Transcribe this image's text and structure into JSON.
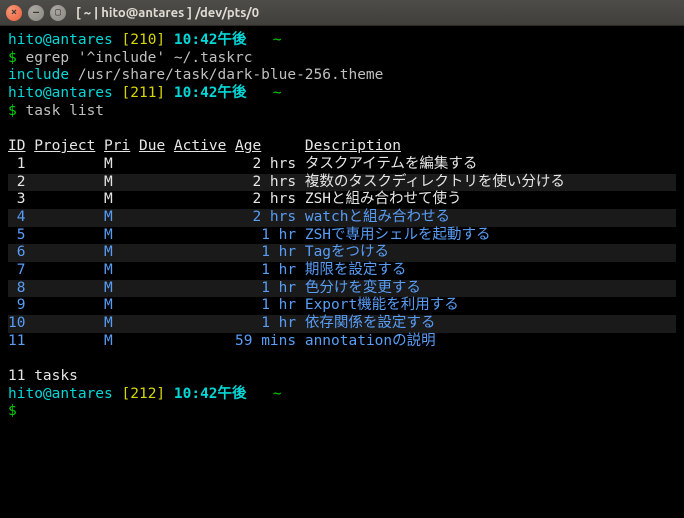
{
  "titlebar": {
    "title": "[ ~ | hito@antares ]  /dev/pts/0"
  },
  "prompt1": {
    "userhost": "hito@antares",
    "histnum": "[210]",
    "time": "10:42午後",
    "marker": "~"
  },
  "cmd1": {
    "dollar": "$",
    "text": "egrep '^include' ~/.taskrc"
  },
  "out1": {
    "word": "include",
    "rest": " /usr/share/task/dark-blue-256.theme"
  },
  "prompt2": {
    "userhost": "hito@antares",
    "histnum": "[211]",
    "time": "10:42午後",
    "marker": "~"
  },
  "cmd2": {
    "dollar": "$",
    "text": "task list"
  },
  "headers": {
    "id": "ID",
    "project": "Project",
    "pri": "Pri",
    "due": "Due",
    "active": "Active",
    "age": "Age",
    "desc": "Description"
  },
  "rows": [
    {
      "id": "1",
      "pri": "M",
      "age": "2 hrs",
      "desc": "タスクアイテムを編集する",
      "color": "white",
      "alt": false
    },
    {
      "id": "2",
      "pri": "M",
      "age": "2 hrs",
      "desc": "複数のタスクディレクトリを使い分ける",
      "color": "white",
      "alt": true
    },
    {
      "id": "3",
      "pri": "M",
      "age": "2 hrs",
      "desc": "ZSHと組み合わせて使う",
      "color": "white",
      "alt": false
    },
    {
      "id": "4",
      "pri": "M",
      "age": "2 hrs",
      "desc": "watchと組み合わせる",
      "color": "blue",
      "alt": true
    },
    {
      "id": "5",
      "pri": "M",
      "age": "1 hr",
      "desc": "ZSHで専用シェルを起動する",
      "color": "blue",
      "alt": false
    },
    {
      "id": "6",
      "pri": "M",
      "age": "1 hr",
      "desc": "Tagをつける",
      "color": "blue",
      "alt": true
    },
    {
      "id": "7",
      "pri": "M",
      "age": "1 hr",
      "desc": "期限を設定する",
      "color": "blue",
      "alt": false
    },
    {
      "id": "8",
      "pri": "M",
      "age": "1 hr",
      "desc": "色分けを変更する",
      "color": "blue",
      "alt": true
    },
    {
      "id": "9",
      "pri": "M",
      "age": "1 hr",
      "desc": "Export機能を利用する",
      "color": "blue",
      "alt": false
    },
    {
      "id": "10",
      "pri": "M",
      "age": "1 hr",
      "desc": "依存関係を設定する",
      "color": "blue",
      "alt": true
    },
    {
      "id": "11",
      "pri": "M",
      "age": "59 mins",
      "desc": "annotationの説明",
      "color": "blue",
      "alt": false
    }
  ],
  "summary": "11 tasks",
  "prompt3": {
    "userhost": "hito@antares",
    "histnum": "[212]",
    "time": "10:42午後",
    "marker": "~"
  },
  "cmd3": {
    "dollar": "$"
  }
}
